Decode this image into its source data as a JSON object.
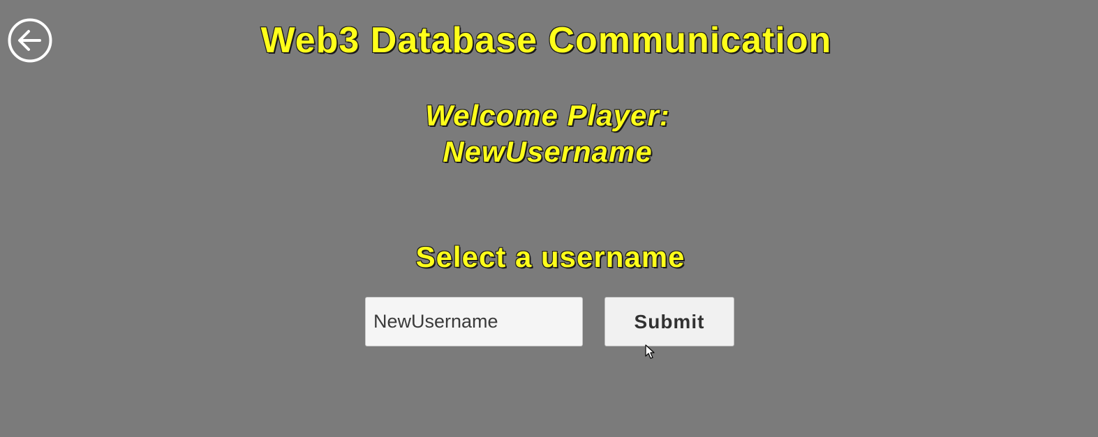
{
  "back_button": {
    "icon": "arrow-left-circle-icon"
  },
  "header": {
    "title": "Web3 Database Communication"
  },
  "welcome": {
    "line1": "Welcome Player:",
    "username": "NewUsername"
  },
  "form": {
    "label": "Select a username",
    "input_value": "NewUsername",
    "submit_label": "Submit"
  },
  "theme": {
    "background": "#7b7b7b",
    "text_fill": "#ffff1a",
    "text_outline": "#111111",
    "button_bg": "#f1f1f1"
  }
}
